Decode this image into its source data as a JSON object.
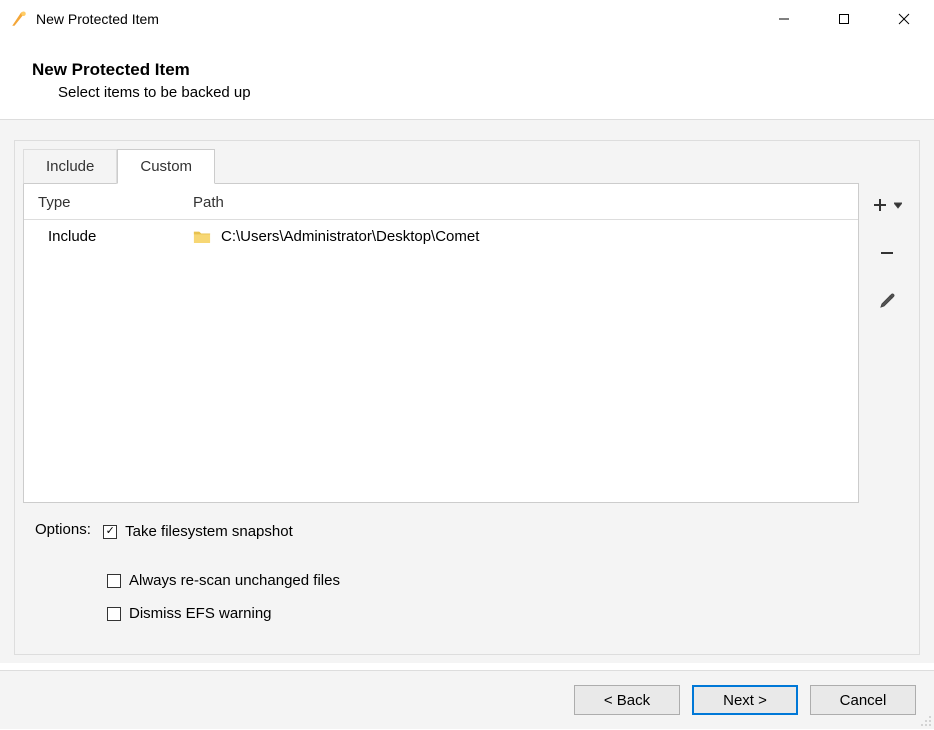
{
  "window": {
    "title": "New Protected Item"
  },
  "header": {
    "title": "New Protected Item",
    "subtitle": "Select items to be backed up"
  },
  "tabs": {
    "include": "Include",
    "custom": "Custom"
  },
  "table": {
    "col_type": "Type",
    "col_path": "Path",
    "rows": [
      {
        "type": "Include",
        "path": "C:\\Users\\Administrator\\Desktop\\Comet"
      }
    ]
  },
  "options": {
    "label": "Options:",
    "snapshot": {
      "label": "Take filesystem snapshot",
      "checked": true
    },
    "rescan": {
      "label": "Always re-scan unchanged files",
      "checked": false
    },
    "efs": {
      "label": "Dismiss EFS warning",
      "checked": false
    }
  },
  "footer": {
    "back": "< Back",
    "next": "Next >",
    "cancel": "Cancel"
  }
}
